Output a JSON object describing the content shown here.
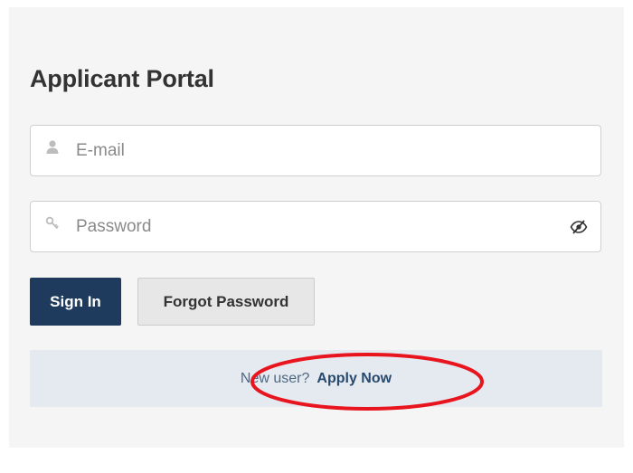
{
  "page": {
    "title": "Applicant Portal"
  },
  "form": {
    "email": {
      "placeholder": "E-mail",
      "value": "",
      "icon": "user-icon"
    },
    "password": {
      "placeholder": "Password",
      "value": "",
      "icon": "key-icon",
      "toggle_icon": "eye-slash-icon"
    }
  },
  "buttons": {
    "sign_in": "Sign In",
    "forgot_password": "Forgot Password"
  },
  "new_user": {
    "lead_text": "New user?",
    "link_text": "Apply Now"
  },
  "colors": {
    "primary_button": "#1e3a5c",
    "annotation_circle": "#e8141e",
    "banner_bg": "#e4eaf0"
  }
}
